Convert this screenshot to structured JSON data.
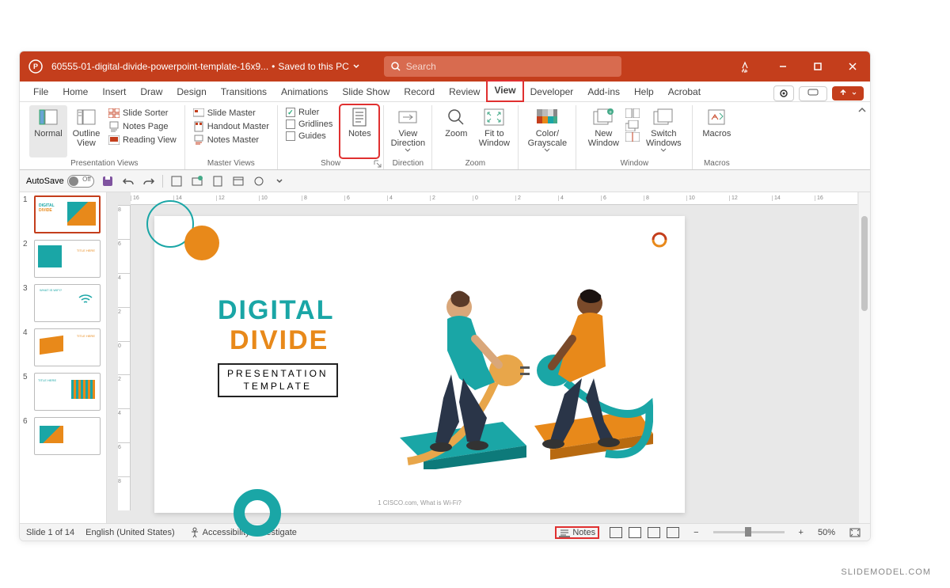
{
  "titlebar": {
    "filename": "60555-01-digital-divide-powerpoint-template-16x9...",
    "saved_status": "Saved to this PC",
    "search_placeholder": "Search"
  },
  "tabs": [
    "File",
    "Home",
    "Insert",
    "Draw",
    "Design",
    "Transitions",
    "Animations",
    "Slide Show",
    "Record",
    "Review",
    "View",
    "Developer",
    "Add-ins",
    "Help",
    "Acrobat"
  ],
  "active_tab": "View",
  "ribbon": {
    "presentation_views": {
      "label": "Presentation Views",
      "normal": "Normal",
      "outline": "Outline View",
      "slide_sorter": "Slide Sorter",
      "notes_page": "Notes Page",
      "reading_view": "Reading View"
    },
    "master_views": {
      "label": "Master Views",
      "slide_master": "Slide Master",
      "handout_master": "Handout Master",
      "notes_master": "Notes Master"
    },
    "show": {
      "label": "Show",
      "ruler": "Ruler",
      "gridlines": "Gridlines",
      "guides": "Guides",
      "notes": "Notes"
    },
    "direction": {
      "label": "Direction",
      "view_direction": "View Direction"
    },
    "zoom": {
      "label": "Zoom",
      "zoom": "Zoom",
      "fit": "Fit to Window"
    },
    "color": {
      "label": "",
      "color_grayscale": "Color/ Grayscale"
    },
    "window": {
      "label": "Window",
      "new_window": "New Window",
      "switch": "Switch Windows"
    },
    "macros": {
      "label": "Macros",
      "macros": "Macros"
    }
  },
  "qat": {
    "autosave": "AutoSave",
    "autosave_state": "Off"
  },
  "slide": {
    "heading1": "DIGITAL",
    "heading2": "DIVIDE",
    "sub1": "PRESENTATION",
    "sub2": "TEMPLATE",
    "footer": "1 CISCO.com, What is Wi-Fi?"
  },
  "thumbs": {
    "count": 6
  },
  "statusbar": {
    "slide_indicator": "Slide 1 of 14",
    "language": "English (United States)",
    "accessibility": "Accessibility: Investigate",
    "notes": "Notes",
    "zoom": "50%"
  },
  "watermark": "SLIDEMODEL.COM"
}
